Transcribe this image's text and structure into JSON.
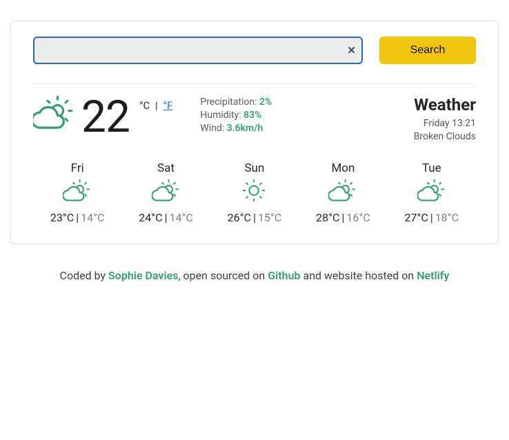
{
  "search": {
    "placeholder": "",
    "value": "",
    "button_label": "Search",
    "clear_glyph": "✕"
  },
  "current": {
    "temp": "22",
    "unit_c": "°C",
    "unit_sep": "|",
    "unit_f": "°F",
    "icon": "partly-cloudy",
    "stats": {
      "precip_label": "Precipitation:",
      "precip_value": "2%",
      "humidity_label": "Humidity:",
      "humidity_value": "83%",
      "wind_label": "Wind:",
      "wind_value": "3.6km/h"
    },
    "heading": "Weather",
    "datetime": "Friday 13:21",
    "description": "Broken Clouds"
  },
  "forecast": [
    {
      "day": "Fri",
      "icon": "partly-cloudy",
      "high": "23°C",
      "low": "14°C"
    },
    {
      "day": "Sat",
      "icon": "partly-cloudy",
      "high": "24°C",
      "low": "14°C"
    },
    {
      "day": "Sun",
      "icon": "sunny",
      "high": "26°C",
      "low": "15°C"
    },
    {
      "day": "Mon",
      "icon": "partly-cloudy",
      "high": "28°C",
      "low": "16°C"
    },
    {
      "day": "Tue",
      "icon": "partly-cloudy",
      "high": "27°C",
      "low": "18°C"
    }
  ],
  "footer": {
    "pre": "Coded by ",
    "author": "Sophie Davies",
    "mid1": ", open sourced on ",
    "github": "Github",
    "mid2": " and website hosted on ",
    "netlify": "Netlify"
  }
}
